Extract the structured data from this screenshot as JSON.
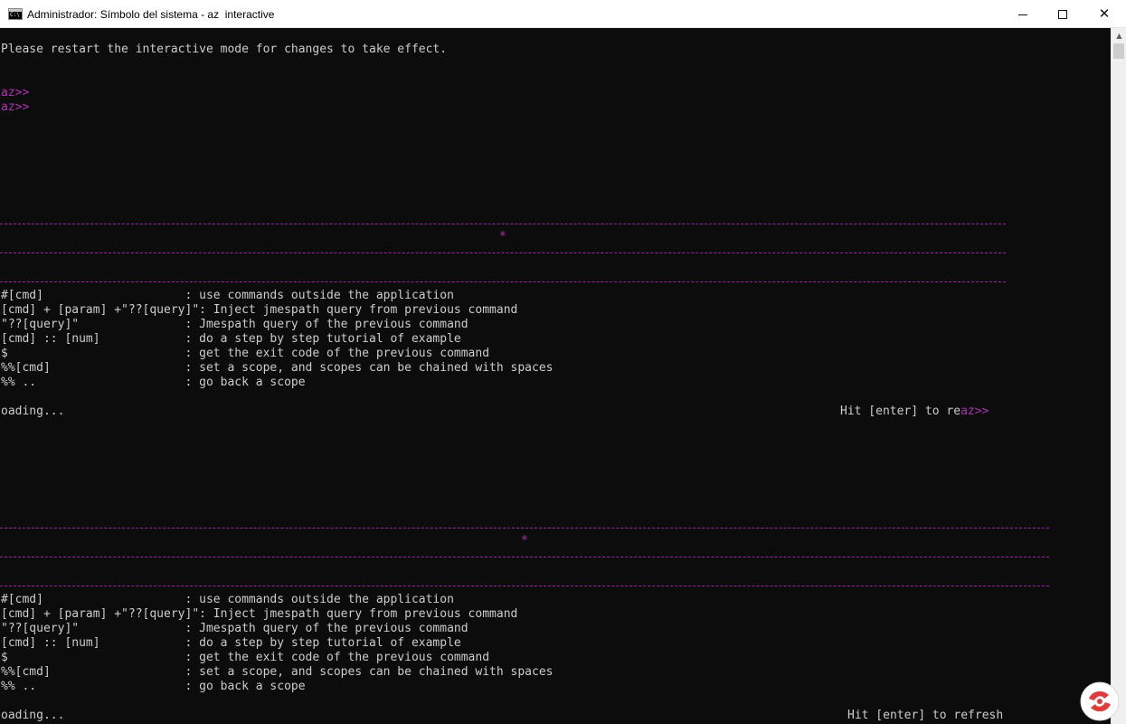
{
  "window": {
    "title": "Administrador: Símbolo del sistema - az  interactive",
    "icon": "cmd-icon",
    "controls": {
      "minimize_icon": "minimize-icon",
      "maximize_icon": "maximize-icon",
      "close_icon": "close-icon",
      "close_glyph": "✕"
    }
  },
  "console": {
    "restart_message": "Please restart the interactive mode for changes to take effect.",
    "prompt": "az>>",
    "star": "*",
    "help_block_1": [
      "#[cmd]                    : use commands outside the application",
      "[cmd] + [param] +\"??[query]\": Inject jmespath query from previous command",
      "\"??[query]\"               : Jmespath query of the previous command",
      "[cmd] :: [num]            : do a step by step tutorial of example",
      "$                         : get the exit code of the previous command",
      "%%[cmd]                   : set a scope, and scopes can be chained with spaces",
      "%% ..                     : go back a scope"
    ],
    "loading_1": "oading...",
    "hint_1_text": "Hit [enter] to re",
    "hint_1_prompt": "az>>",
    "help_block_2": [
      "#[cmd]                    : use commands outside the application",
      "[cmd] + [param] +\"??[query]\": Inject jmespath query from previous command",
      "\"??[query]\"               : Jmespath query of the previous command",
      "[cmd] :: [num]            : do a step by step tutorial of example",
      "$                         : get the exit code of the previous command",
      "%%[cmd]                   : set a scope, and scopes can be chained with spaces",
      "%% ..                     : go back a scope"
    ],
    "loading_2": "oading...",
    "hint_2_text": "Hit [enter] to refresh"
  },
  "colors": {
    "console_bg": "#0c0c0c",
    "console_text": "#cccccc",
    "prompt_magenta": "#b12fb6"
  },
  "scrollbar": {
    "up_arrow": "▲"
  }
}
